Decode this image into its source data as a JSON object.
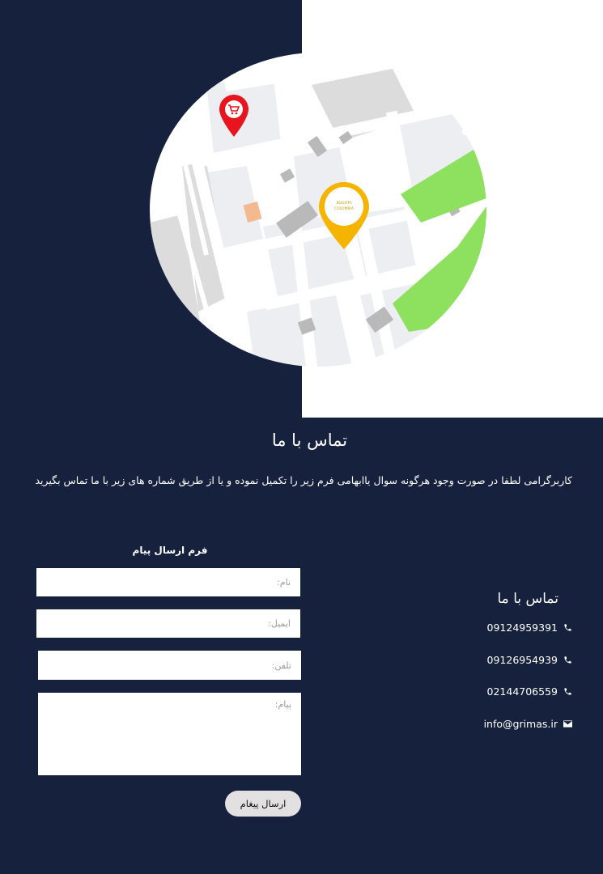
{
  "contact_section": {
    "title": "تماس با ما",
    "intro": "کاربرگرامی لطفا در صورت وجود هرگونه سوال یاابهامی فرم زیر را تکمیل نموده و یا از طریق شماره های زیر با ما تماس بگیرید"
  },
  "map": {
    "center_pin_text_1": "BOGOTA",
    "center_pin_text_2": "COLOMBIA"
  },
  "form": {
    "title": "فرم ارسال پیام",
    "name_placeholder": "نام:",
    "email_placeholder": "ایمیل:",
    "phone_placeholder": "تلفن:",
    "message_placeholder": "پیام:",
    "submit_label": "ارسال پیغام"
  },
  "contact_info": {
    "title": "تماس با ما",
    "phones": [
      "09124959391",
      "09126954939",
      "02144706559"
    ],
    "email": "info@grimas.ir"
  },
  "colors": {
    "background": "#16213e",
    "panel": "#ffffff",
    "pin_red": "#e8141e",
    "pin_yellow": "#f5b400",
    "pin_purple": "#8e2bd1",
    "park_green": "#8ee05f"
  },
  "icons": {
    "phone": "phone-icon",
    "email": "envelope-icon",
    "shop_pin": "shopping-cart-pin-icon",
    "location_pin": "location-pin-icon"
  }
}
